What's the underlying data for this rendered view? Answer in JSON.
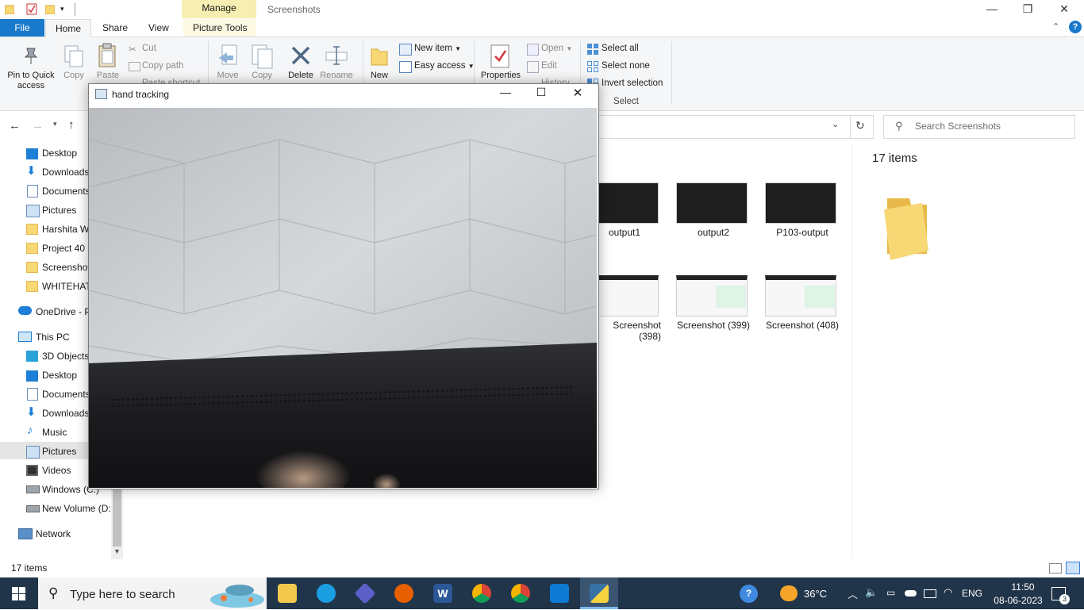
{
  "titlebar": {
    "manage_label": "Manage",
    "window_title": "Screenshots",
    "minimize": "—",
    "restore": "❐",
    "close": "✕"
  },
  "tabs": {
    "file": "File",
    "home": "Home",
    "share": "Share",
    "view": "View",
    "picture_tools": "Picture Tools"
  },
  "ribbon": {
    "pin_to_quick_access": "Pin to Quick access",
    "copy": "Copy",
    "paste": "Paste",
    "cut": "Cut",
    "copy_path": "Copy path",
    "paste_shortcut": "Paste shortcut",
    "move_to": "Move",
    "copy_to": "Copy",
    "delete": "Delete",
    "rename": "Rename",
    "new_folder": "New",
    "new_item": "New item",
    "easy_access": "Easy access",
    "properties": "Properties",
    "open": "Open",
    "edit": "Edit",
    "history": "History",
    "select_all": "Select all",
    "select_none": "Select none",
    "invert_selection": "Invert selection",
    "select_group": "Select"
  },
  "search": {
    "placeholder": "Search Screenshots"
  },
  "nav": {
    "quick": [
      "Desktop",
      "Downloads",
      "Documents",
      "Pictures",
      "Harshita W",
      "Project 40",
      "Screenshot",
      "WHITEHAT"
    ],
    "onedrive": "OneDrive - P",
    "this_pc": "This PC",
    "pc_items": [
      "3D Objects",
      "Desktop",
      "Documents",
      "Downloads",
      "Music",
      "Pictures",
      "Videos",
      "Windows (C:)",
      "New Volume (D:"
    ],
    "network": "Network"
  },
  "files": {
    "row1": [
      "output1",
      "output2",
      "P103-output"
    ],
    "row2": [
      "Screenshot (398)",
      "Screenshot (399)",
      "Screenshot (408)"
    ]
  },
  "preview": {
    "item_count": "17 items"
  },
  "status": {
    "item_count": "17 items"
  },
  "cv_window": {
    "title": "hand tracking"
  },
  "taskbar": {
    "search_placeholder": "Type here to search",
    "temperature": "36°C",
    "language": "ENG",
    "time": "11:50",
    "date": "08-06-2023",
    "notifications": "3"
  },
  "colors": {
    "file_tab": "#1979ca",
    "taskbar": "#20344a",
    "manage_tab": "#f7efb1"
  }
}
